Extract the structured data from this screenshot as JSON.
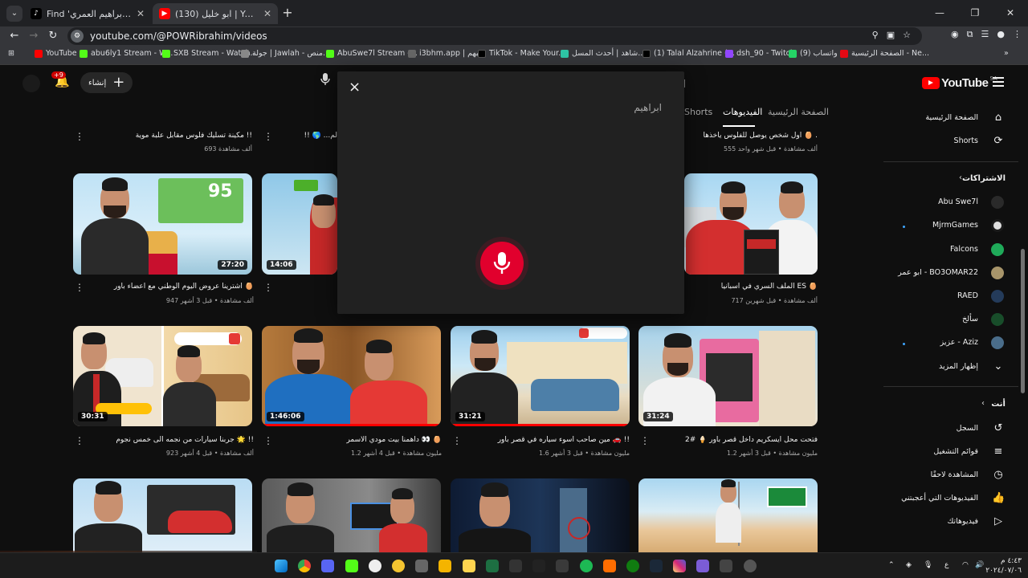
{
  "browser": {
    "tabs": [
      {
        "title": "Find 'مساعدة ابراهيم العمري' on",
        "active": false
      },
      {
        "title": "(130) ابو خليل | YouTube",
        "active": true
      }
    ],
    "new_tab": "+",
    "url": "youtube.com/@POWRibrahim/videos",
    "bookmarks": [
      "YouTube",
      "abu6ly1 Stream - W...",
      "SXB Stream - Watch...",
      "جولة | Jawlah - منص...",
      "AbuSwe7l Stream -...",
      "i3bhm.app | لعبهم",
      "TikTok - Make Your...",
      "شاهد | أحدث المسل...",
      "(1) Talal Alzahrine (...",
      "dsh_90 - Twitch",
      "واتساب (9)",
      "الصفحة الرئيسية - Ne..."
    ]
  },
  "youtube": {
    "create_label": "إنشاء",
    "notification_count": "+9",
    "logo_text": "YouTube",
    "logo_region": "SA",
    "channel_tabs": {
      "home": "الصفحة الرئيسية",
      "videos": "الفيديوهات",
      "shorts": "Shorts"
    },
    "top_row": [
      {
        "title": "مكينة تسليك فلوس مقابل علبة موية !!",
        "meta": "693 ألف مشاهدة"
      },
      {
        "title": "!! 🌎 ...لم",
        "meta": ""
      },
      {
        "title": "اول شخص يوصل للفلوس ياخذها 🥚 .",
        "meta": "555 ألف مشاهدة • قبل شهر واحد"
      }
    ],
    "rows": [
      [
        {
          "title": "اشترينا عروض اليوم الوطني مع أعضاء باور 🥚",
          "meta": "947 ألف مشاهدة • قبل 3 أشهر",
          "duration": "27:20"
        },
        {
          "title": "",
          "meta": "",
          "duration": "14:06"
        },
        {
          "title": "",
          "meta": "",
          "duration": ""
        },
        {
          "title": "الملف السري في اسبانيا ES 🥚",
          "meta": "717 ألف مشاهدة • قبل شهرين",
          "duration": ""
        }
      ],
      [
        {
          "title": "جربنا سيارات من نجمه الى خمس نجوم 🌟 !!",
          "meta": "923 ألف مشاهدة • قبل 4 أشهر",
          "duration": "30:31"
        },
        {
          "title": "داهمنا بيت مودي الأسمر 👀 🥚",
          "meta": "1.2 مليون مشاهدة • قبل 4 أشهر",
          "duration": "1:46:06"
        },
        {
          "title": "مين صاحب اسوء سياره في قصر باور 🚗 !!",
          "meta": "1.6 مليون مشاهدة • قبل 3 أشهر",
          "duration": "31:21"
        },
        {
          "title": "فتحت محل آيسكريم داخل قصر باور 🍦 #2",
          "meta": "1.2 مليون مشاهدة • قبل 3 أشهر",
          "duration": "31:24"
        }
      ]
    ],
    "sidebar": {
      "home": "الصفحة الرئيسية",
      "shorts": "Shorts",
      "subscriptions_heading": "الاشتراكات",
      "subscriptions": [
        "Abu Swe7l",
        "MjrmGames",
        "Falcons",
        "ابو عمر - BO3OMAR22",
        "RAED",
        "سألخ",
        "عزيز - Aziz"
      ],
      "show_more": "إظهار المزيد",
      "you_heading": "أنت",
      "you_items": [
        "السجل",
        "قوائم التشغيل",
        "المشاهدة لاحقًا",
        "الفيديوهات التي أعجبتني",
        "فيديوهاتك"
      ]
    }
  },
  "voice_dialog": {
    "close": "×",
    "transcript": "ابراهيم"
  },
  "taskbar": {
    "time": "٤:٤٣ م",
    "date": "٢٠٢٤/٠٧/٠٦",
    "lang": "ع"
  },
  "colors": {
    "accent": "#ff0000",
    "mic": "#e1002d",
    "background": "#0f0f0f"
  }
}
